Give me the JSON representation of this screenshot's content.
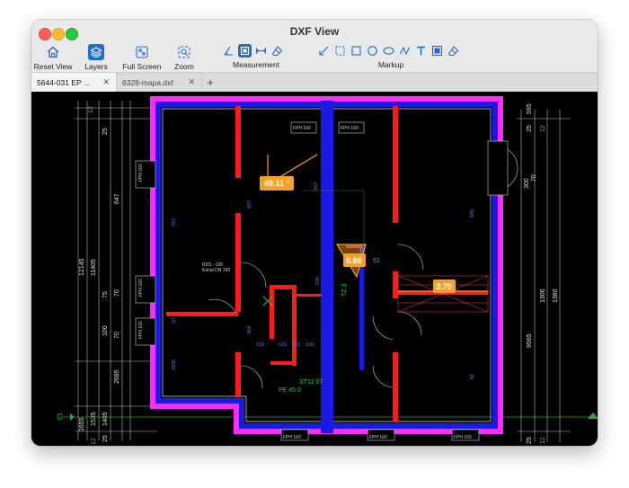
{
  "window": {
    "title": "DXF View"
  },
  "toolbar": {
    "reset_view": "Reset View",
    "layers": "Layers",
    "full_screen": "Full Screen",
    "zoom": "Zoom",
    "measurement": "Measurement",
    "markup": "Markup"
  },
  "tabs": [
    {
      "label": "5644-031 EP ...",
      "active": true
    },
    {
      "label": "6328-mapa.dxf",
      "active": false
    }
  ],
  "drawing": {
    "measure_angle": "49.11 °",
    "measure_area": "0.86",
    "measure_length": "3.70",
    "left_dims_v": [
      "12",
      "25",
      "647",
      "12145",
      "11405",
      "75",
      "70",
      "100",
      "70",
      "2685",
      "1535",
      "1405",
      "1655",
      "25",
      "12"
    ],
    "left_dims_small": [
      "10",
      "70",
      "100",
      "70",
      "25",
      "125",
      "12"
    ],
    "right_dims": [
      "25",
      "12",
      "595",
      "300",
      "70",
      "1306",
      "1380",
      "9565",
      "25",
      "12"
    ],
    "axis_label": "C",
    "room_text_1": "RDS ~100",
    "room_text_2": "Konal DN 150",
    "fh_labels": [
      "FPH 160",
      "FPH 160",
      "FPH 160",
      "FPH 160",
      "FPH 160",
      "FPH 160",
      "FPH 160",
      "FPH 160"
    ],
    "blue_dims": [
      "797",
      "657",
      "507",
      "685",
      "304",
      "130",
      "615",
      "755",
      "100",
      "3435",
      "10",
      "61",
      "100"
    ],
    "green_notes": [
      "TZ 3",
      "ST12 07",
      "PE 45.0",
      "61"
    ]
  },
  "colors": {
    "wall_blue": "#1a1ae6",
    "wall_magenta": "#ff2bff",
    "wall_red": "#ff1a1a",
    "measure_orange": "#f5a02a",
    "accent": "#1d6bd6"
  }
}
